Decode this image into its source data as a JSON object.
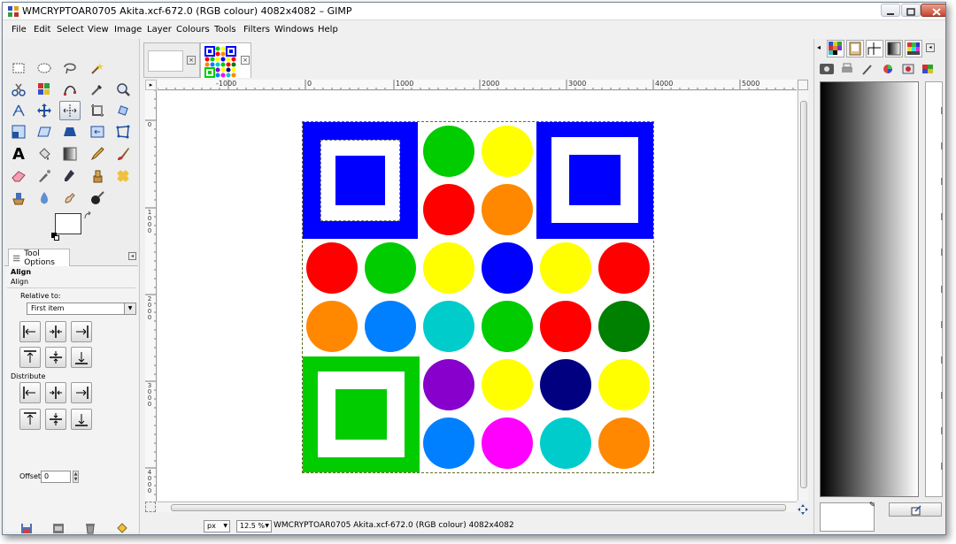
{
  "window": {
    "title": "WMCRYPTOAR0705 Akita.xcf-672.0 (RGB colour) 4082x4082 – GIMP"
  },
  "menu": [
    "File",
    "Edit",
    "Select",
    "View",
    "Image",
    "Layer",
    "Colours",
    "Tools",
    "Filters",
    "Windows",
    "Help"
  ],
  "toolbox": {
    "tools": [
      "rect-select-icon",
      "ellipse-select-icon",
      "lasso-icon",
      "fuzzy-select-icon",
      "scissors-icon",
      "color-select-icon",
      "paths-icon",
      "color-picker-icon",
      "zoom-icon",
      "measure-icon",
      "move-icon",
      "align-icon",
      "crop-icon",
      "rotate-icon",
      "scale-icon",
      "shear-icon",
      "perspective-icon",
      "flip-icon",
      "cage-icon",
      "text-icon",
      "bucket-fill-icon",
      "blend-icon",
      "pencil-icon",
      "paintbrush-icon",
      "eraser-icon",
      "airbrush-icon",
      "ink-icon",
      "clone-icon",
      "heal-icon",
      "perspective-clone-icon",
      "blur-icon",
      "smudge-icon",
      "dodge-burn-icon"
    ]
  },
  "tool_options": {
    "tab_label": "Tool Options",
    "heading": "Align",
    "subheading": "Align",
    "relative_label": "Relative to:",
    "relative_value": "First item",
    "distribute_label": "Distribute",
    "offset_label": "Offset:",
    "offset_value": "0"
  },
  "rulers": {
    "h_labels": [
      "-1000",
      "0",
      "1000",
      "2000",
      "3000",
      "4000",
      "5000"
    ],
    "v_labels": [
      "0",
      "1000",
      "2000",
      "3000",
      "4000"
    ]
  },
  "status": {
    "unit": "px",
    "zoom": "12.5 %",
    "text": "WMCRYPTOAR0705 Akita.xcf-672.0 (RGB colour) 4082x4082"
  },
  "image": {
    "colors": {
      "blue": "#0000ff",
      "green": "#00cc00",
      "yellow": "#ffff00",
      "red": "#ff0000",
      "orange": "#ff8800",
      "azure": "#0080ff",
      "cyan": "#00cccc",
      "dark_green": "#008000",
      "purple": "#8800cc",
      "navy": "#000080",
      "magenta": "#ff00ff"
    },
    "finder_squares": [
      {
        "position": "top-left",
        "color": "#0000ff"
      },
      {
        "position": "top-right",
        "color": "#0000ff"
      },
      {
        "position": "bottom-left",
        "color": "#00cc00"
      }
    ],
    "circle_grid": [
      [
        null,
        null,
        "#00cc00",
        "#ffff00",
        null,
        null
      ],
      [
        null,
        null,
        "#ff0000",
        "#ff8800",
        null,
        null
      ],
      [
        "#ff0000",
        "#00cc00",
        "#ffff00",
        "#0000ff",
        "#ffff00",
        "#ff0000"
      ],
      [
        "#ff8800",
        "#0080ff",
        "#00cccc",
        "#00cc00",
        "#ff0000",
        "#008000"
      ],
      [
        null,
        null,
        "#8800cc",
        "#ffff00",
        "#000080",
        "#ffff00"
      ],
      [
        null,
        null,
        "#0080ff",
        "#ff00ff",
        "#00cccc",
        "#ff8800"
      ]
    ]
  }
}
